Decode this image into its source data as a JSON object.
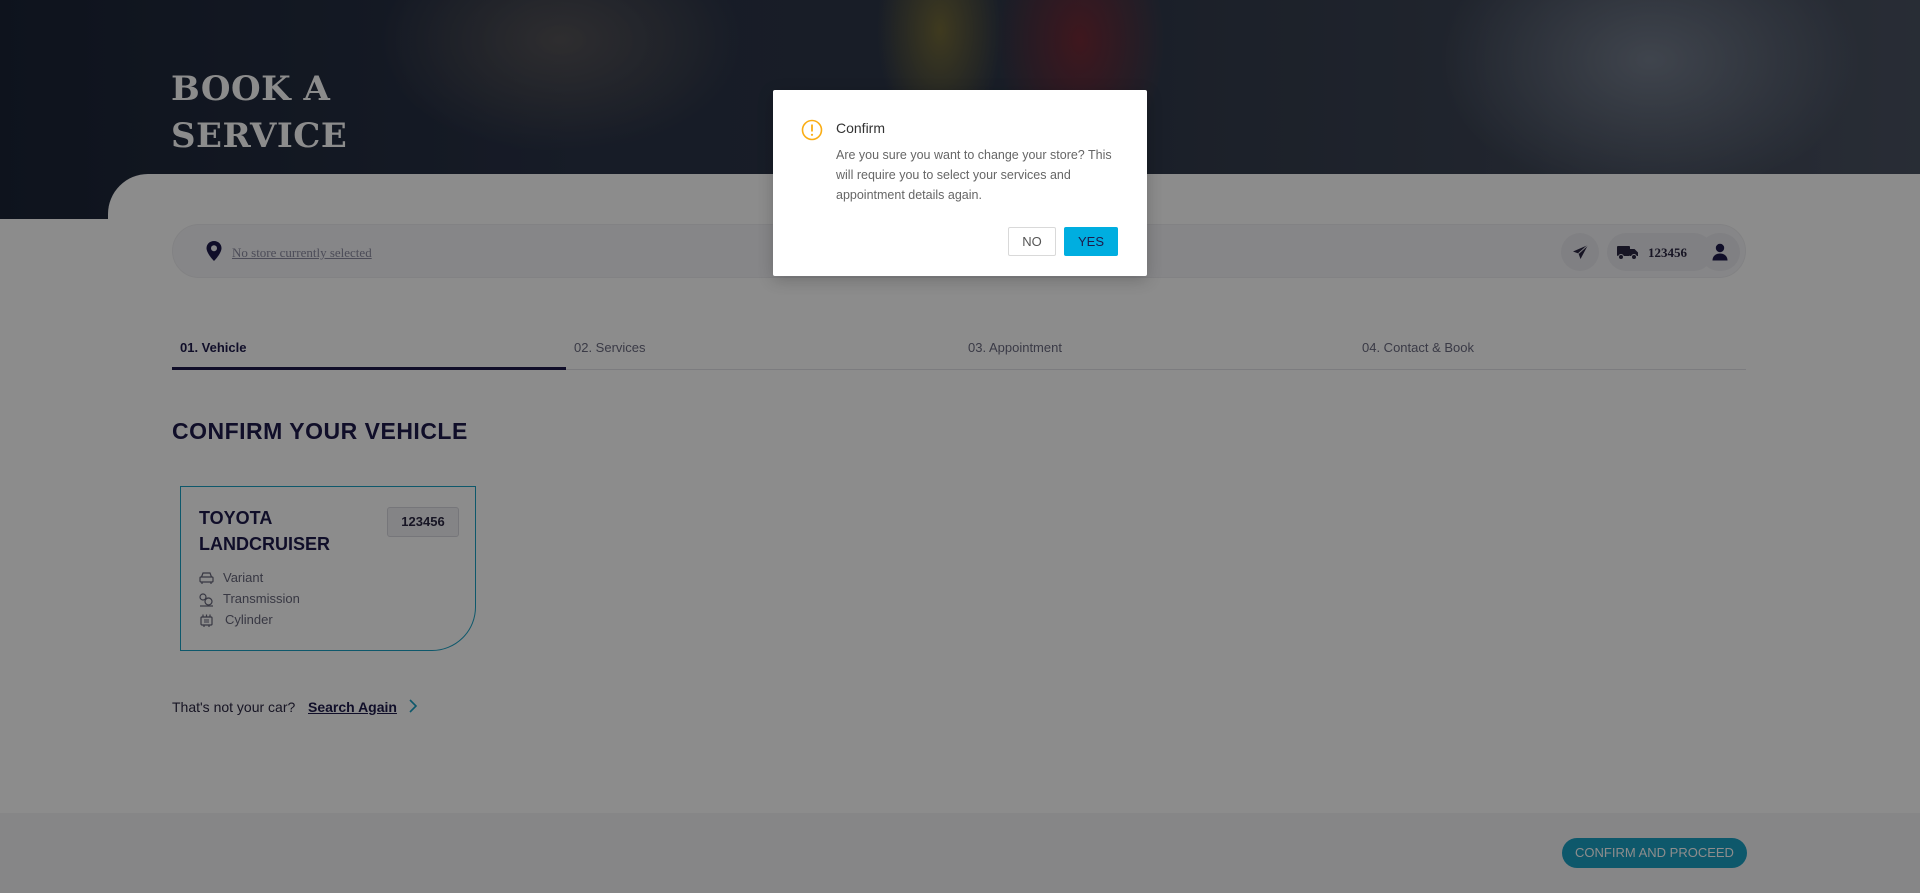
{
  "hero": {
    "title_line1": "BOOK A",
    "title_line2": "SERVICE"
  },
  "store_bar": {
    "store_text": "No store currently selected",
    "rego": "123456"
  },
  "tabs": [
    {
      "label": "01. Vehicle",
      "active": true
    },
    {
      "label": "02. Services",
      "active": false
    },
    {
      "label": "03. Appointment",
      "active": false
    },
    {
      "label": "04. Contact & Book",
      "active": false
    }
  ],
  "main": {
    "section_title": "CONFIRM YOUR VEHICLE",
    "vehicle": {
      "name_line1": "TOYOTA",
      "name_line2": "LANDCRUISER",
      "rego": "123456",
      "specs": [
        {
          "icon": "car-icon",
          "label": "Variant"
        },
        {
          "icon": "transmission-icon",
          "label": "Transmission"
        },
        {
          "icon": "engine-icon",
          "label": "Cylinder"
        }
      ]
    },
    "not_your_car": "That's not your car?",
    "search_again": "Search Again"
  },
  "footer": {
    "confirm_label": "CONFIRM AND PROCEED"
  },
  "modal": {
    "icon": "exclamation-circle-icon",
    "title": "Confirm",
    "message": "Are you sure you want to change your store? This will require you to select your services and appointment details again.",
    "no_label": "NO",
    "yes_label": "YES"
  },
  "colors": {
    "brand_navy": "#1e1b4b",
    "accent_teal": "#1aa0c4",
    "yes_button": "#00aee0",
    "warning": "#faad14"
  }
}
